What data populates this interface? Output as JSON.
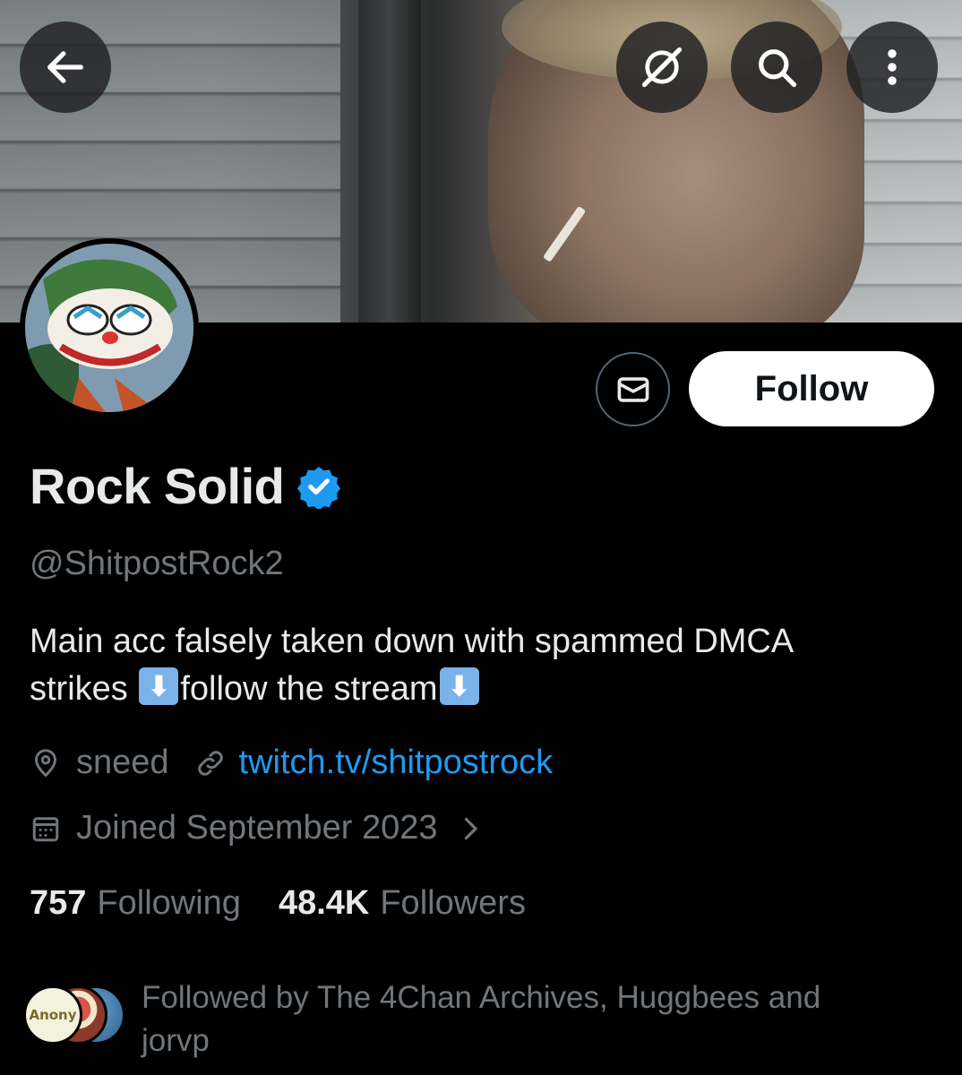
{
  "header": {
    "back_icon": "arrow-left-icon",
    "grok_icon": "grok-icon",
    "search_icon": "search-icon",
    "more_icon": "more-vertical-icon"
  },
  "profile": {
    "name": "Rock Solid",
    "verified": true,
    "handle": "@ShitpostRock2",
    "bio_line1": "Main acc falsely taken down with spammed DMCA",
    "bio_line2_a": "strikes ",
    "bio_line2_b": "follow the stream",
    "location": "sneed",
    "website": "twitch.tv/shitpostrock",
    "joined": "Joined September 2023",
    "following_count": "757",
    "following_label": "Following",
    "followers_count": "48.4K",
    "followers_label": "Followers",
    "followed_by": "Followed by The 4Chan Archives, Huggbees and jorvp",
    "follower_avatar_text": "Anony"
  },
  "actions": {
    "follow_label": "Follow",
    "message_icon": "envelope-icon"
  },
  "colors": {
    "background": "#000000",
    "link": "#1d9bf0",
    "verified": "#1d9bf0",
    "muted_text": "#71767b"
  }
}
